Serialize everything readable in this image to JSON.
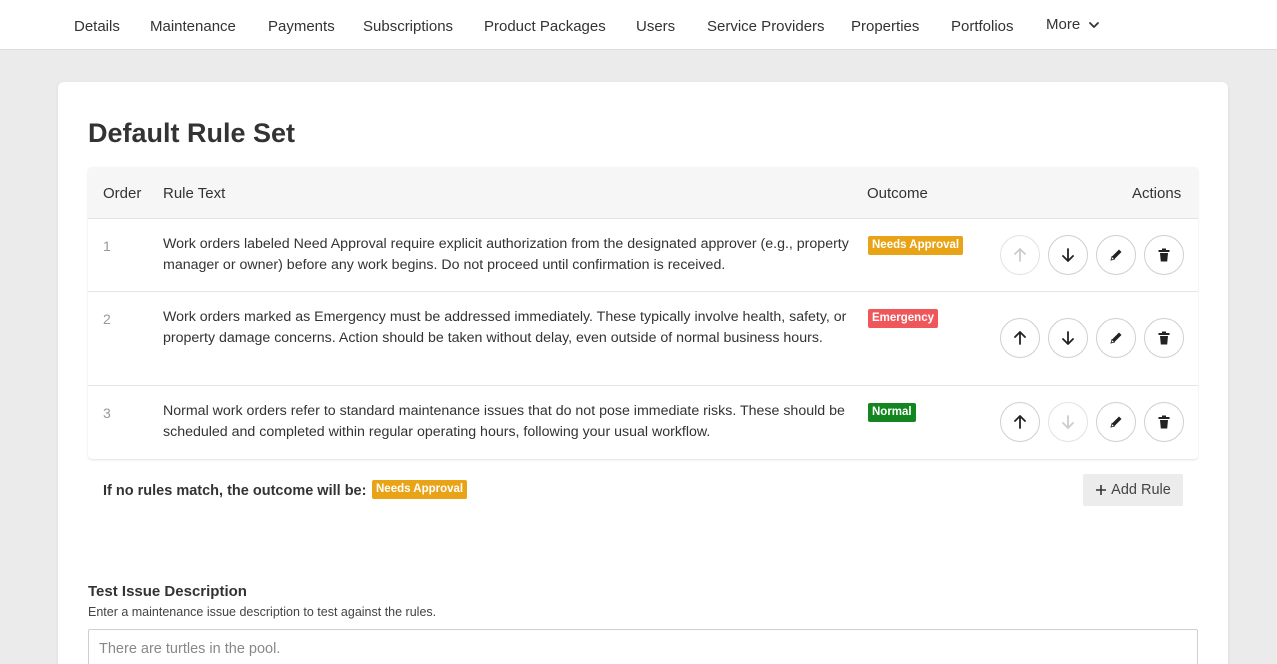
{
  "nav": {
    "items": [
      "Details",
      "Maintenance",
      "Payments",
      "Subscriptions",
      "Product Packages",
      "Users",
      "Service Providers",
      "Properties",
      "Portfolios"
    ],
    "more_label": "More"
  },
  "page": {
    "title": "Default Rule Set"
  },
  "table": {
    "headers": {
      "order": "Order",
      "rule_text": "Rule Text",
      "outcome": "Outcome",
      "actions": "Actions"
    },
    "rows": [
      {
        "order": "1",
        "text": "Work orders labeled Need Approval require explicit authorization from the designated approver (e.g., property manager or owner) before any work begins. Do not proceed until confirmation is received.",
        "outcome": "Needs Approval",
        "up_disabled": true,
        "down_disabled": false
      },
      {
        "order": "2",
        "text": "Work orders marked as Emergency must be addressed immediately. These typically involve health, safety, or property damage concerns. Action should be taken without delay, even outside of normal business hours.",
        "outcome": "Emergency",
        "up_disabled": false,
        "down_disabled": false
      },
      {
        "order": "3",
        "text": "Normal work orders refer to standard maintenance issues that do not pose immediate risks. These should be scheduled and completed within regular operating hours, following your usual workflow.",
        "outcome": "Normal",
        "up_disabled": false,
        "down_disabled": true
      }
    ]
  },
  "fallback": {
    "label": "If no rules match, the outcome will be:",
    "outcome": "Needs Approval"
  },
  "add_rule_label": "Add Rule",
  "test": {
    "label": "Test Issue Description",
    "help": "Enter a maintenance issue description to test against the rules.",
    "placeholder": "There are turtles in the pool."
  },
  "colors": {
    "needs_approval": "#e8a317",
    "emergency": "#f0575b",
    "normal": "#13861f"
  }
}
